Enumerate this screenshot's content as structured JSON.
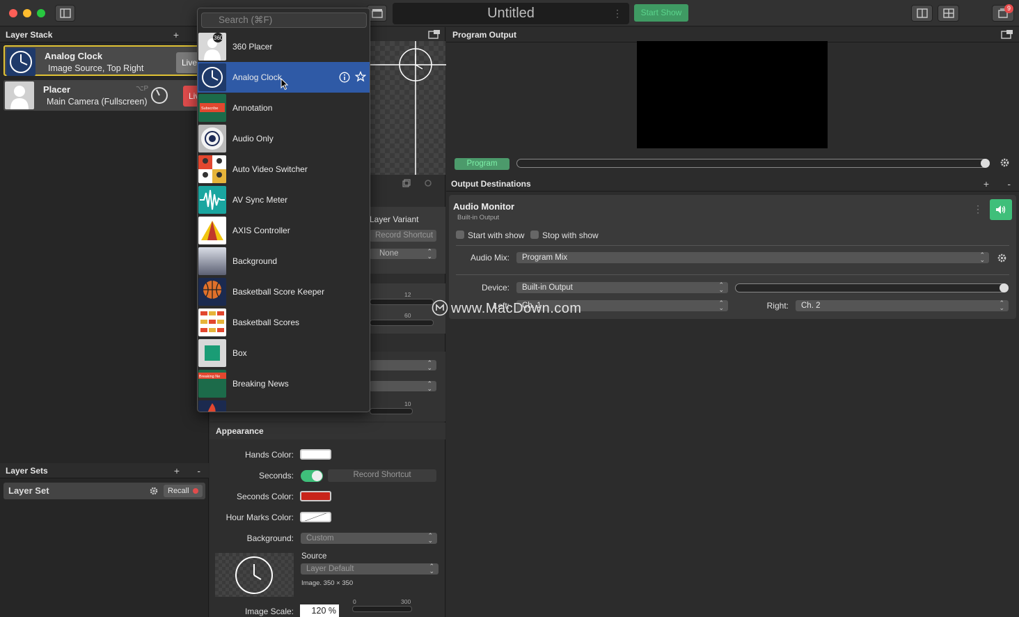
{
  "window": {
    "title": "Untitled",
    "start_show_label": "Start Show",
    "notification_count": "9"
  },
  "layer_stack": {
    "title": "Layer Stack",
    "add": "+",
    "layers": [
      {
        "name": "Analog Clock",
        "subtitle": "Image Source, Top Right",
        "live": "Live"
      },
      {
        "name": "Placer",
        "subtitle": "Main Camera (Fullscreen)",
        "live": "Live",
        "shortcut": "⌥P"
      }
    ]
  },
  "layer_sets": {
    "title": "Layer Sets",
    "add": "+",
    "remove": "-",
    "set_name": "Layer Set",
    "recall": "Recall"
  },
  "source_menu": {
    "search_placeholder": "Search (⌘F)",
    "items": [
      {
        "label": "360 Placer"
      },
      {
        "label": "Analog Clock"
      },
      {
        "label": "Annotation"
      },
      {
        "label": "Audio Only"
      },
      {
        "label": "Auto Video Switcher"
      },
      {
        "label": "AV Sync Meter"
      },
      {
        "label": "AXIS Controller"
      },
      {
        "label": "Background"
      },
      {
        "label": "Basketball Score Keeper"
      },
      {
        "label": "Basketball Scores"
      },
      {
        "label": "Box"
      },
      {
        "label": "Breaking News"
      }
    ]
  },
  "inspector": {
    "layer_variant": "Layer Variant",
    "record_shortcut": "Record Shortcut",
    "none_option": "None",
    "tick_12": "12",
    "tick_60": "60",
    "tick_10": "10",
    "appearance_title": "Appearance",
    "hands_color_label": "Hands Color:",
    "seconds_label": "Seconds:",
    "seconds_shortcut": "Record Shortcut",
    "seconds_color_label": "Seconds Color:",
    "hour_marks_label": "Hour Marks Color:",
    "background_label": "Background:",
    "background_value": "Custom",
    "source_label": "Source",
    "source_value": "Layer Default",
    "image_info": "Image. 350 × 350",
    "image_scale_label": "Image Scale:",
    "image_scale_value": "120 %",
    "scale_min": "0",
    "scale_max": "300"
  },
  "program": {
    "title": "Program Output",
    "program_label": "Program"
  },
  "output_destinations": {
    "title": "Output Destinations",
    "add": "+",
    "remove": "-",
    "monitor": {
      "name": "Audio Monitor",
      "subtitle": "Built-in Output",
      "start_with_show": "Start with show",
      "stop_with_show": "Stop with show",
      "audio_mix_label": "Audio Mix:",
      "audio_mix_value": "Program Mix",
      "device_label": "Device:",
      "device_value": "Built-in Output",
      "left_label": "Left:",
      "left_value": "Ch. 1",
      "right_label": "Right:",
      "right_value": "Ch. 2"
    }
  },
  "watermark": "www.MacDown.com",
  "colors": {
    "accent_green": "#3fbf7a",
    "live_red": "#e04c4c",
    "selection_blue": "#2f5aa6",
    "selected_border": "#e0c234",
    "seconds_color": "#c8241a"
  }
}
